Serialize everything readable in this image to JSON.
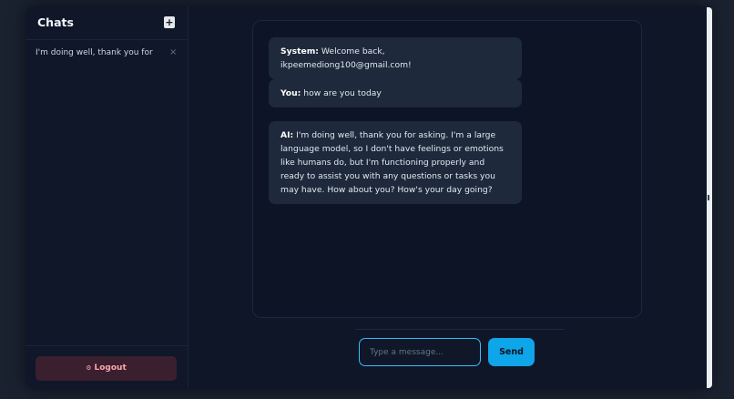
{
  "sidebar": {
    "title": "Chats",
    "new_chat_label": "+",
    "chats": [
      {
        "label": "I'm doing well, thank you for",
        "delete_label": "×"
      }
    ],
    "logout_icon": "⚙",
    "logout_label": "Logout"
  },
  "messages": [
    {
      "sender": "System:",
      "text": "Welcome back, ikpeemediong100@gmail.com!"
    },
    {
      "sender": "You:",
      "text": "how are you today"
    },
    {
      "sender": "AI:",
      "text": "I'm doing well, thank you for asking. I'm a large language model, so I don't have feelings or emotions like humans do, but I'm functioning properly and ready to assist you with any questions or tasks you may have. How about you? How's your day going?"
    }
  ],
  "composer": {
    "placeholder": "Type a message...",
    "value": "",
    "send_label": "Send"
  },
  "colors": {
    "accent": "#0ea5e9",
    "background": "#0e1628",
    "message_bubble": "#1e293b",
    "logout": "#fda4af"
  }
}
